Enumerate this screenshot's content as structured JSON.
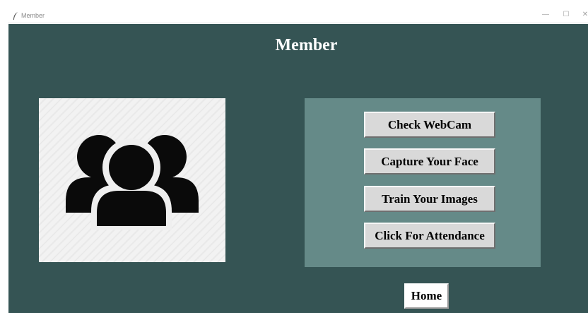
{
  "window": {
    "title": "Member",
    "app_icon": "feather-icon",
    "controls": {
      "minimize": "—",
      "maximize": "☐",
      "close": "✕"
    }
  },
  "page": {
    "title": "Member",
    "image_icon": "people-group-icon"
  },
  "actions": {
    "check_webcam": "Check WebCam",
    "capture_face": "Capture Your Face",
    "train_images": "Train Your Images",
    "attendance": "Click For Attendance"
  },
  "nav": {
    "home": "Home"
  },
  "colors": {
    "background": "#355454",
    "button_panel": "#658a88",
    "button": "#d9d9d9",
    "title_text": "#ffffff"
  }
}
